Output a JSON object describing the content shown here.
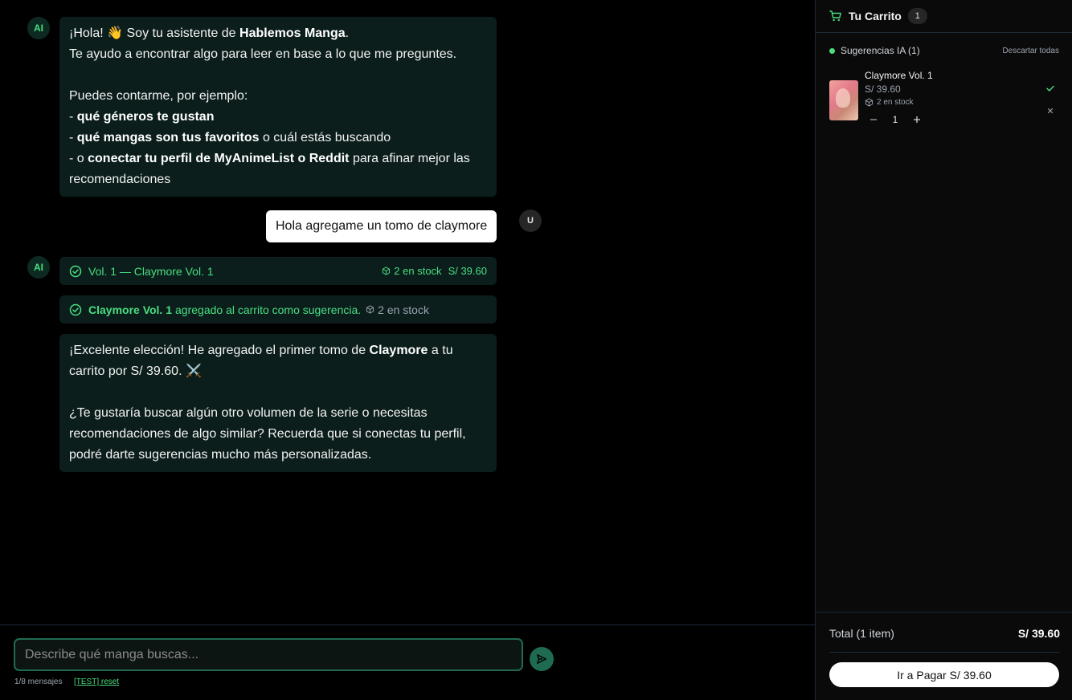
{
  "chat": {
    "ai_avatar": "AI",
    "user_avatar": "U",
    "msg1": {
      "l1_pre": "¡Hola! 👋 Soy tu asistente de ",
      "l1_bold": "Hablemos Manga",
      "l1_post": ".",
      "l2": "Te ayudo a encontrar algo para leer en base a lo que me preguntes.",
      "l3": "Puedes contarme, por ejemplo:",
      "b1_pre": "- ",
      "b1_bold": "qué géneros te gustan",
      "b2_pre": "- ",
      "b2_bold": "qué mangas son tus favoritos",
      "b2_post": " o cuál estás buscando",
      "b3_pre": "- o ",
      "b3_bold": "conectar tu perfil de MyAnimeList o Reddit",
      "b3_post": " para afinar mejor las recomendaciones"
    },
    "user_msg": "Hola agregame un tomo de claymore",
    "tool1": {
      "label": "Vol. 1 — Claymore Vol. 1",
      "stock": "2 en stock",
      "price": "S/ 39.60"
    },
    "tool2": {
      "bold": "Claymore Vol. 1",
      "text": "agregado al carrito como sugerencia.",
      "stock": "2 en stock"
    },
    "msg3": {
      "p1_pre": "¡Excelente elección! He agregado el primer tomo de ",
      "p1_bold": "Claymore",
      "p1_post": " a tu carrito por S/ 39.60. ⚔️",
      "p2": "¿Te gustaría buscar algún otro volumen de la serie o necesitas recomendaciones de algo similar? Recuerda que si conectas tu perfil, podré darte sugerencias mucho más personalizadas."
    }
  },
  "input": {
    "placeholder": "Describe qué manga buscas...",
    "counter": "1/8 mensajes",
    "reset": "[TEST] reset"
  },
  "cart": {
    "title": "Tu Carrito",
    "count": "1",
    "suggestions_label": "Sugerencias IA (1)",
    "discard_all": "Descartar todas",
    "item": {
      "title": "Claymore Vol. 1",
      "price": "S/ 39.60",
      "stock": "2 en stock",
      "qty": "1"
    },
    "total_label": "Total (1 item)",
    "total_value": "S/ 39.60",
    "pay_button": "Ir a Pagar S/ 39.60"
  },
  "colors": {
    "accent": "#4ade80",
    "bubble": "#0b1e1c",
    "send_button": "#1f6b52"
  }
}
